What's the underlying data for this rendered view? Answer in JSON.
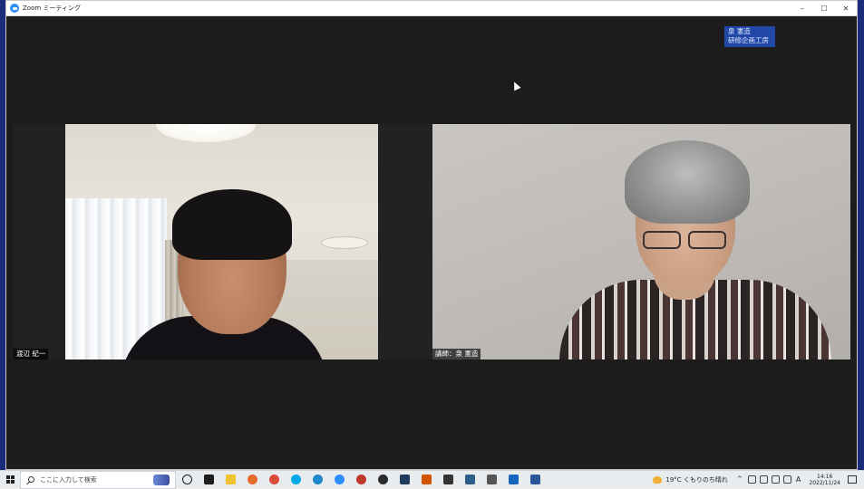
{
  "window": {
    "title": "Zoom ミーティング",
    "controls": {
      "minimize": "–",
      "maximize": "☐",
      "close": "✕"
    }
  },
  "meeting": {
    "watermark": {
      "line1": "泉 憲造",
      "line2": "研修企画工房"
    },
    "participants": [
      {
        "name": "渡辺 紀一"
      },
      {
        "name": "講師：泉 憲造"
      }
    ]
  },
  "taskbar": {
    "search_placeholder": "ここに入力して検索",
    "apps": [
      {
        "icon": "cortana-icon",
        "color": "#1d1d1d"
      },
      {
        "icon": "task-view-icon",
        "color": "#1d1d1d"
      },
      {
        "icon": "file-explorer-icon",
        "color": "#f2c230"
      },
      {
        "icon": "firefox-icon",
        "color": "#e66a2c"
      },
      {
        "icon": "chrome-icon",
        "color": "#dd4b39"
      },
      {
        "icon": "skype-icon",
        "color": "#00a8e8"
      },
      {
        "icon": "edge-icon",
        "color": "#1e88c8"
      },
      {
        "icon": "zoom-icon",
        "color": "#2d8cff"
      },
      {
        "icon": "record-icon",
        "color": "#c0392b"
      },
      {
        "icon": "obs-icon",
        "color": "#2b2b2b"
      },
      {
        "icon": "video-editor-icon",
        "color": "#1f3a5a"
      },
      {
        "icon": "recorder-icon",
        "color": "#d35400"
      },
      {
        "icon": "terminal-icon",
        "color": "#333333"
      },
      {
        "icon": "monitor-icon",
        "color": "#2e5d8a"
      },
      {
        "icon": "camera-icon",
        "color": "#555555"
      },
      {
        "icon": "outlook-icon",
        "color": "#1565c0"
      },
      {
        "icon": "word-icon",
        "color": "#2b579a"
      }
    ],
    "weather": "19°C くもりのち晴れ",
    "ime": "A",
    "clock": {
      "time": "14:16",
      "date": "2022/11/24"
    }
  }
}
